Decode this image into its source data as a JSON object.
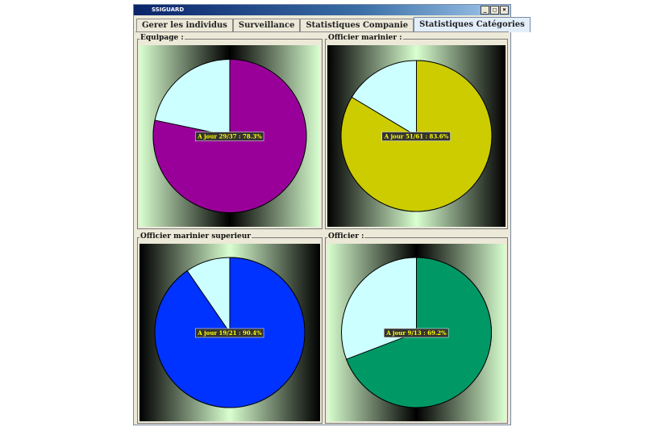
{
  "window": {
    "title": "SSIGUARD",
    "buttons": [
      "_",
      "□",
      "×"
    ]
  },
  "tabs": [
    {
      "label": "Gerer les individus"
    },
    {
      "label": "Surveillance"
    },
    {
      "label": "Statistiques Companie"
    },
    {
      "label": "Statistiques Catégories",
      "active": true
    }
  ],
  "panels": [
    {
      "title": "Equipage :",
      "label": "A jour 29/37 : 78.3%",
      "fraction": 0.783,
      "color": "#990099",
      "background": "green-black-green"
    },
    {
      "title": "Officier marinier :",
      "label": "A jour 51/61 : 83.6%",
      "fraction": 0.836,
      "color": "#cccc00",
      "background": "black-green-black"
    },
    {
      "title": "Officier marinier superieur",
      "label": "A jour 19/21 : 90.4%",
      "fraction": 0.904,
      "color": "#0033ff",
      "background": "black-green-black"
    },
    {
      "title": "Officier :",
      "label": "A jour 9/13 : 69.2%",
      "fraction": 0.692,
      "color": "#009966",
      "background": "green-black-green"
    }
  ],
  "colors": {
    "remainder": "#ccffff",
    "label_box": "#333333",
    "label_text": "#ffff00"
  }
}
